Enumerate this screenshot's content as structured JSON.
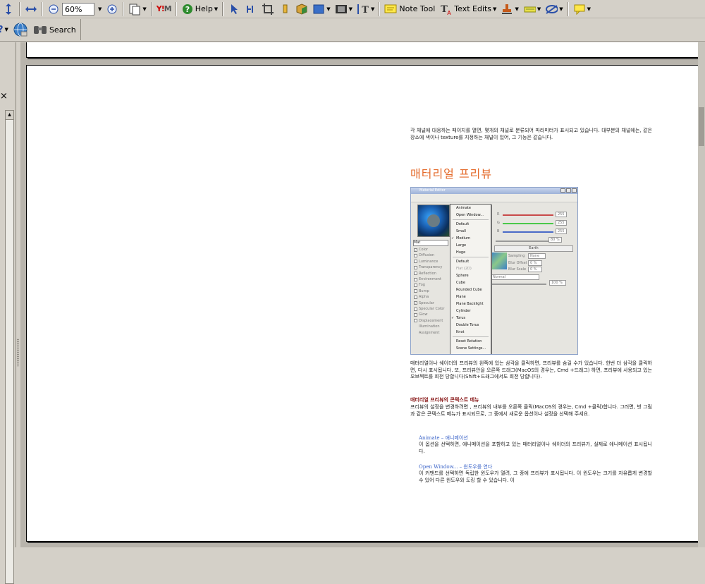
{
  "toolbar": {
    "zoom_value": "60%",
    "note_tool_label": "Note Tool",
    "text_edits_label": "Text Edits",
    "help_label": "Help",
    "search_label": "Search"
  },
  "document": {
    "intro": "각 채널에 대응하는 페이지를 열면, 몇개의 채널로 분류되어 파라미터가 표시되고 있습니다. 대부분의 채널에는, 같은 장소에 색이나 texture를 지정하는 채널이 있어, 그 기능은 같습니다.",
    "heading": "매터리얼 프리뷰",
    "para1": "매터리얼이나 쉐이더의 프리뷰의 왼쪽에 있는 삼각을 클릭하면, 프리뷰를 숨길 수가 있습니다. 한번 더 삼각을 클릭하면, 다시 표시됩니다. 또, 프리뷰안을 오른쪽 드래그(MacOS의 경우는, Cmd +드래그) 하면, 프리뷰에 사용되고 있는 오브젝트를 회전 당합니다(Shift+드래그에서도 회전 당합니다).",
    "subheading": "매터리얼 프리뷰의 콘텍스트 메뉴",
    "para2": "프리뷰의 설정을 변경하려면 , 프리뷰의 내부를 오른쪽 클릭(MacOS의 경우는, Cmd +클릭)합니다. 그러면, 벗 그림과 같은 콘텍스트 메뉴가 표시되므로, 그 중에서 새로운 옵션이나 설정을 선택해 주세요.",
    "item1_title": "Animate – 애니메이션",
    "item1_text": "이 옵션을 선택하면, 애니메이션을 포함하고 있는 매터리얼이나 쉐이더의 프리뷰가, 실제로 애니메이션 표시됩니다.",
    "item2_title": "Open Window... – 윈도우를 연다",
    "item2_text": "이 커맨드를 선택하면 독립한 윈도우가 열려, 그 중에 프리뷰가 표시됩니다. 이 윈도우는 크기를 자유롭게 변경할 수 있어 다른 윈도우와 도킹 할 수 있습니다. 이"
  },
  "material_editor": {
    "title": "Material Editor",
    "name_field": "Mat",
    "channels": [
      "Color",
      "Diffusion",
      "Luminance",
      "Transparency",
      "Reflection",
      "Environment",
      "Fog",
      "Bump",
      "Alpha",
      "Specular",
      "Specular Color",
      "Glow",
      "Displacement",
      "Illumination",
      "Assignment"
    ],
    "rgb": [
      "R",
      "G",
      "B"
    ],
    "rgb_values": [
      "255",
      "255",
      "255"
    ],
    "brightness": "80 %",
    "texture_label": "Earth",
    "sampling_label": "Sampling",
    "sampling_value": "None",
    "blur_offset_label": "Blur Offset",
    "blur_offset_value": "0 %",
    "blur_scale_label": "Blur Scale",
    "blur_scale_value": "0 %",
    "mix_value": "Normal",
    "percent_value": "100 %",
    "menu": [
      {
        "label": "Animate",
        "type": "item"
      },
      {
        "label": "Open Window...",
        "type": "item"
      },
      {
        "type": "sep"
      },
      {
        "label": "Default",
        "type": "item"
      },
      {
        "label": "Small",
        "type": "item"
      },
      {
        "label": "Medium",
        "type": "check"
      },
      {
        "label": "Large",
        "type": "item"
      },
      {
        "label": "Huge",
        "type": "item"
      },
      {
        "type": "sep"
      },
      {
        "label": "Default",
        "type": "item"
      },
      {
        "label": "Flat (2D)",
        "type": "disabled"
      },
      {
        "label": "Sphere",
        "type": "item"
      },
      {
        "label": "Cube",
        "type": "item"
      },
      {
        "label": "Rounded Cube",
        "type": "item"
      },
      {
        "label": "Plane",
        "type": "item"
      },
      {
        "label": "Plane Backlight",
        "type": "item"
      },
      {
        "label": "Cylinder",
        "type": "item"
      },
      {
        "label": "Torus",
        "type": "check"
      },
      {
        "label": "Double Torus",
        "type": "item"
      },
      {
        "label": "Knot",
        "type": "item"
      },
      {
        "type": "sep"
      },
      {
        "label": "Reset Rotation",
        "type": "item"
      },
      {
        "label": "Scene Settings...",
        "type": "item"
      }
    ]
  },
  "colors": {
    "heading": "#e46a2a",
    "subheading": "#8a1b1b",
    "link": "#3a63c8"
  }
}
